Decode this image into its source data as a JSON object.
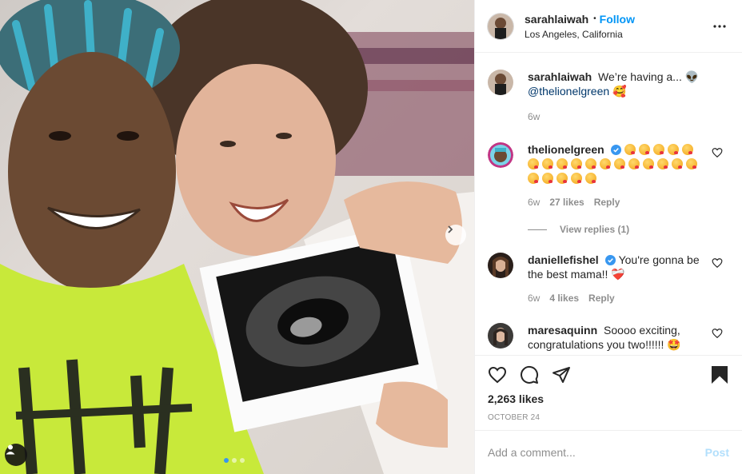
{
  "post": {
    "username": "sarahlaiwah",
    "follow_label": "Follow",
    "dot": "•",
    "location": "Los Angeles, California",
    "more_icon": "more-horizontal-icon"
  },
  "caption": {
    "username": "sarahlaiwah",
    "text": "We’re having a... 👽",
    "mention": "@thelionelgreen",
    "emoji": "🥰",
    "time": "6w"
  },
  "comments": [
    {
      "username": "thelionelgreen",
      "verified": true,
      "emoji_name": "face-blowing-a-kiss",
      "emoji_count": 22,
      "time": "6w",
      "likes": "27 likes",
      "reply_label": "Reply"
    },
    {
      "username": "daniellefishel",
      "verified": true,
      "text": "You're gonna be the best mama!! ❤️‍🩹",
      "time": "6w",
      "likes": "4 likes",
      "reply_label": "Reply"
    },
    {
      "username": "maresaquinn",
      "verified": false,
      "text": "Soooo exciting, congratulations you two!!!!!! 🤩"
    }
  ],
  "view_replies_label": "View replies (1)",
  "actions": {
    "likes": "2,263 likes",
    "date": "October 24",
    "like_icon": "heart-icon",
    "comment_icon": "comment-icon",
    "share_icon": "share-icon",
    "save_icon": "bookmark-filled-icon"
  },
  "add_comment": {
    "placeholder": "Add a comment...",
    "post_label": "Post"
  },
  "carousel": {
    "total": 3,
    "active": 1
  },
  "colors": {
    "link_blue": "#0095f6",
    "mention": "#00376b",
    "muted": "#8e8e8e",
    "post_disabled": "#b2dffc",
    "verified": "#3897f0"
  }
}
